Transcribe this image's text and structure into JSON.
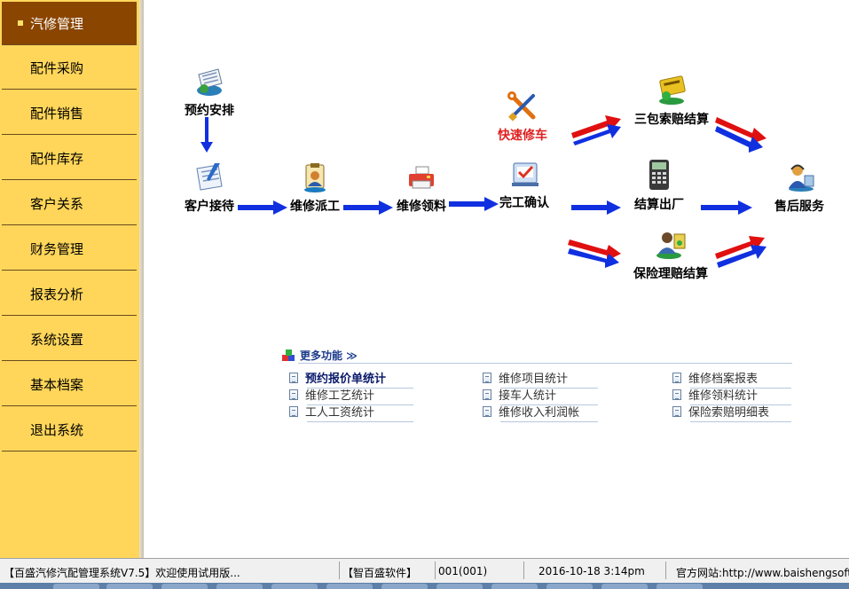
{
  "sidebar": {
    "items": [
      {
        "label": "汽修管理",
        "active": true
      },
      {
        "label": "配件采购"
      },
      {
        "label": "配件销售"
      },
      {
        "label": "配件库存"
      },
      {
        "label": "客户关系"
      },
      {
        "label": "财务管理"
      },
      {
        "label": "报表分析"
      },
      {
        "label": "系统设置"
      },
      {
        "label": "基本档案"
      },
      {
        "label": "退出系统"
      }
    ]
  },
  "flow": {
    "appointment": "预约安排",
    "reception": "客户接待",
    "dispatch": "维修派工",
    "parts_pick": "维修领料",
    "quick_repair": "快速修车",
    "completion": "完工确认",
    "warranty_claim": "三包索赔结算",
    "checkout": "结算出厂",
    "insurance_claim": "保险理赔结算",
    "after_sales": "售后服务"
  },
  "more": {
    "header": "更多功能 ≫",
    "links": [
      "预约报价单统计",
      "维修项目统计",
      "维修档案报表",
      "维修工艺统计",
      "接车人统计",
      "维修领料统计",
      "工人工资统计",
      "维修收入利润帐",
      "保险索赔明细表"
    ]
  },
  "status": {
    "app": "【百盛汽修汽配管理系统V7.5】欢迎使用试用版...",
    "company": "【智百盛软件】",
    "user": "001(001)",
    "datetime": "2016-10-18 3:14pm",
    "website": "官方网站:http://www.baishengsoft.c"
  },
  "colors": {
    "sidebar_bg": "#ffd65a",
    "sidebar_active": "#8a4500",
    "arrow_blue": "#1030e0",
    "arrow_red": "#e01010",
    "quick_repair_text": "#e02020"
  }
}
